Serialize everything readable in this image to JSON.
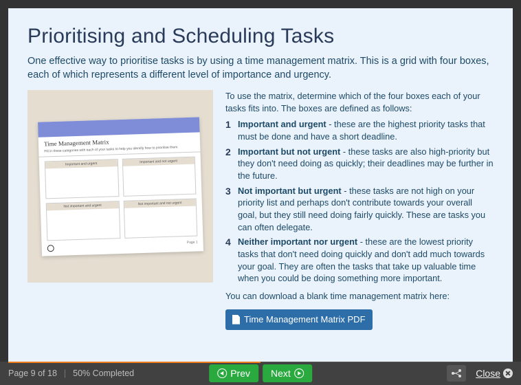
{
  "page": {
    "title": "Prioritising and Scheduling Tasks",
    "intro": "One effective way to prioritise tasks is by using a time management matrix. This is a grid with four boxes, each of which represents a different level of importance and urgency."
  },
  "matrix_thumb": {
    "title": "Time Management Matrix",
    "subtitle": "Fill in these categories with each of your tasks to help you identify how to prioritise them.",
    "quadrants": {
      "q1": "Important and urgent",
      "q2": "Important and not urgent",
      "q3": "Not important and urgent",
      "q4": "Not important and not urgent"
    },
    "page_label": "Page 1"
  },
  "instructions": {
    "lead": "To use the matrix, determine which of the four boxes each of your tasks fits into. The boxes are defined as follows:",
    "items": [
      {
        "term": "Important and urgent",
        "desc": " - these are the highest priority tasks that must be done and have a short deadline."
      },
      {
        "term": "Important but not urgent",
        "desc": " - these tasks are also high-priority but they don't need doing as quickly; their deadlines may be further in the future."
      },
      {
        "term": "Not important but urgent",
        "desc": " - these tasks are not high on your priority list and perhaps don't contribute towards your overall goal, but they still need doing fairly quickly. These are tasks you can often delegate."
      },
      {
        "term": "Neither important nor urgent",
        "desc": " - these are the lowest priority tasks that don't need doing quickly and don't add much towards your goal. They are often the tasks that take up valuable time when you could be doing something more important."
      }
    ],
    "download_prompt": "You can download a blank time management matrix here:",
    "download_label": "Time Management Matrix PDF"
  },
  "footer": {
    "page_status": "Page 9 of 18",
    "progress_text": "50% Completed",
    "progress_percent": 50,
    "prev": "Prev",
    "next": "Next",
    "close": "Close"
  }
}
